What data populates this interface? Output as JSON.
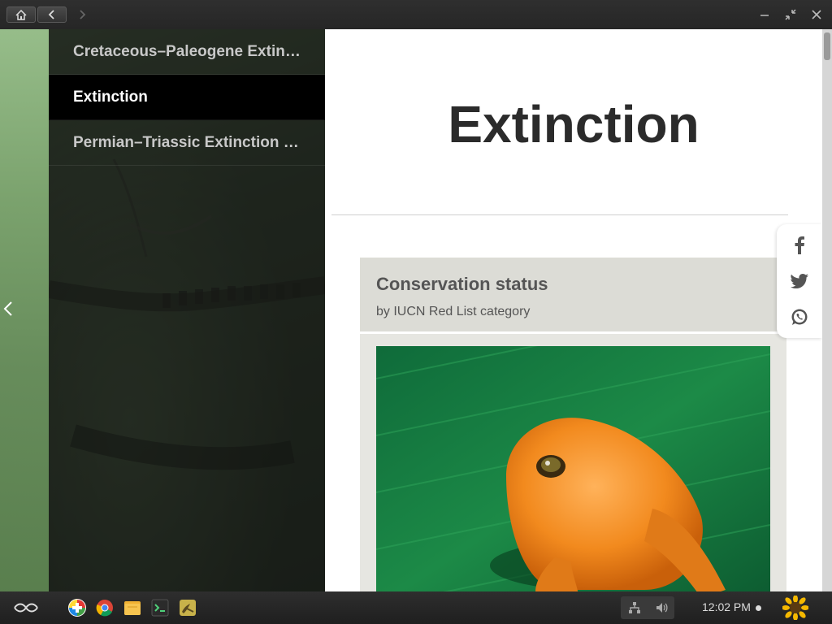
{
  "window": {
    "home_icon": "home-icon",
    "back_icon": "chevron-left-icon",
    "forward_icon": "chevron-right-icon",
    "minimize_icon": "minimize-icon",
    "restore_icon": "restore-icon",
    "close_icon": "close-icon"
  },
  "sidebar": {
    "items": [
      {
        "label": "Cretaceous–Paleogene Extinction Event",
        "active": false
      },
      {
        "label": "Extinction",
        "active": true
      },
      {
        "label": "Permian–Triassic Extinction Event",
        "active": false
      }
    ],
    "collapse_icon": "chevron-left-icon"
  },
  "article": {
    "title": "Extinction",
    "card": {
      "title": "Conservation status",
      "subtitle": "by IUCN Red List category",
      "image_subject": "golden toad on green leaf"
    }
  },
  "share": {
    "icons": [
      "facebook-icon",
      "twitter-icon",
      "whatsapp-icon"
    ]
  },
  "taskbar": {
    "apps": [
      "app-store-icon",
      "chrome-icon",
      "files-icon",
      "terminal-icon",
      "encyclopedia-icon"
    ],
    "clock": "12:02 PM"
  },
  "colors": {
    "active_item_bg": "#000000",
    "title_text": "#2b2b2b",
    "card_bg": "#e6e6e1"
  }
}
